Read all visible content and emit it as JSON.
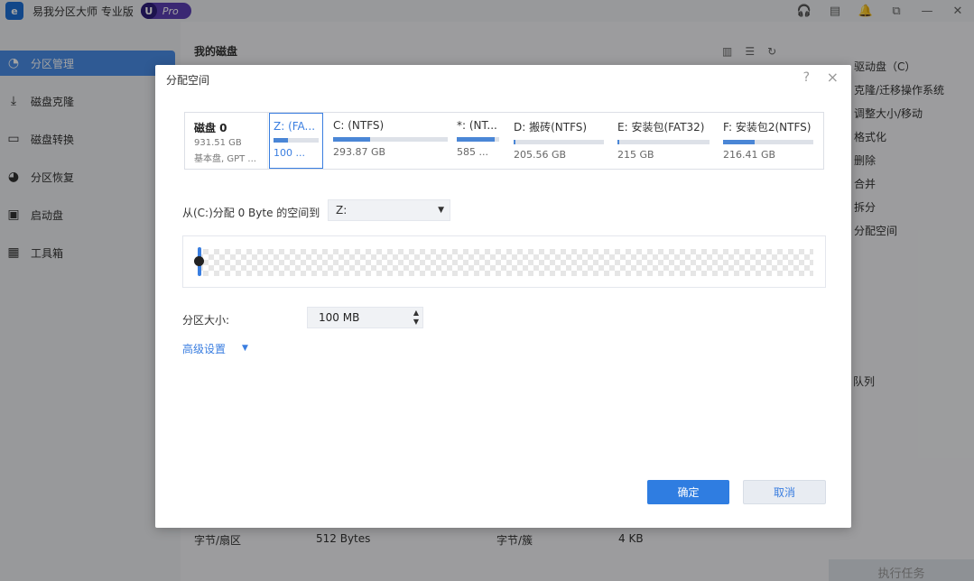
{
  "app": {
    "title": "易我分区大师 专业版",
    "pro_badge": "Pro",
    "pro_badge_letter": "U",
    "logo_letter": "e"
  },
  "titlebar_icons": [
    "headset-icon",
    "note-icon",
    "bell-icon",
    "restore-icon",
    "minimize-icon",
    "close-icon"
  ],
  "sidebar": {
    "items": [
      {
        "label": "分区管理",
        "icon": "pie-chart-icon",
        "active": true
      },
      {
        "label": "磁盘克隆",
        "icon": "download-icon",
        "active": false
      },
      {
        "label": "磁盘转换",
        "icon": "disk-icon",
        "active": false
      },
      {
        "label": "分区恢复",
        "icon": "recovery-icon",
        "active": false
      },
      {
        "label": "启动盘",
        "icon": "usb-icon",
        "active": false
      },
      {
        "label": "工具箱",
        "icon": "toolbox-icon",
        "active": false
      }
    ]
  },
  "main": {
    "title": "我的磁盘"
  },
  "right_panel": {
    "items": [
      "驱动盘（C）",
      "克隆/迁移操作系统",
      "调整大小/移动",
      "格式化",
      "删除",
      "合并",
      "拆分",
      "分配空间"
    ],
    "queue_label": "队列",
    "execute_label": "执行任务"
  },
  "info_row": {
    "bytes_per_sector_label": "字节/扇区",
    "bytes_per_sector_value": "512 Bytes",
    "bytes_per_cluster_label": "字节/簇",
    "bytes_per_cluster_value": "4 KB"
  },
  "dialog": {
    "title": "分配空间",
    "help": "?",
    "close": "×",
    "disk": {
      "name": "磁盘 0",
      "size": "931.51 GB",
      "type": "基本盘, GPT ..."
    },
    "partitions": [
      {
        "label": "Z: (FA...",
        "size": "100 ...",
        "used_fraction": 0.32,
        "selected": true
      },
      {
        "label": "C: (NTFS)",
        "size": "293.87 GB",
        "used_fraction": 0.32,
        "selected": false
      },
      {
        "label": "*: (NT...",
        "size": "585 ...",
        "used_fraction": 0.9,
        "selected": false
      },
      {
        "label": "D: 搬砖(NTFS)",
        "size": "205.56 GB",
        "used_fraction": 0.02,
        "selected": false
      },
      {
        "label": "E: 安装包(FAT32)",
        "size": "215 GB",
        "used_fraction": 0.02,
        "selected": false
      },
      {
        "label": "F: 安装包2(NTFS)",
        "size": "216.41 GB",
        "used_fraction": 0.35,
        "selected": false
      }
    ],
    "allocate_label": "从(C:)分配 0 Byte 的空间到",
    "target_select": "Z:",
    "size_label": "分区大小:",
    "size_value": "100 MB",
    "advanced_label": "高级设置",
    "ok_label": "确定",
    "cancel_label": "取消"
  },
  "colors": {
    "accent": "#2f7de1",
    "sidebar_active": "#4a8ee8",
    "pro_badge": "#5b3fb5"
  }
}
